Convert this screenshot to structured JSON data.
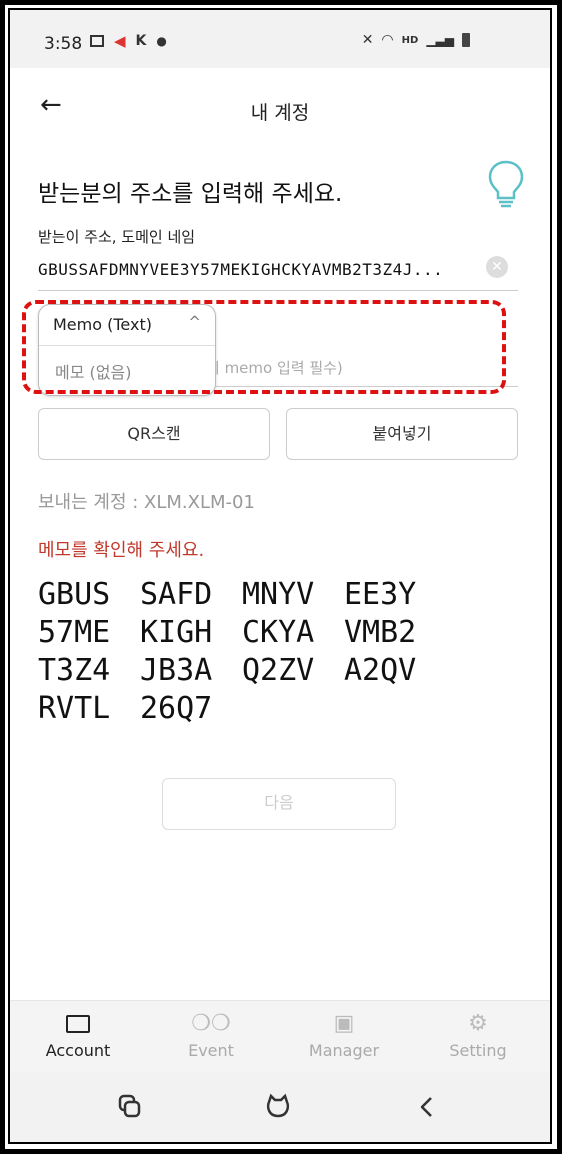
{
  "status_bar": {
    "time": "3:58",
    "left_icons": [
      "image-icon",
      "megaphone-icon",
      "k-icon",
      "dot-icon"
    ],
    "right_icons": [
      "mute-icon",
      "wifi-icon",
      "hd-voice-icon",
      "signal-icon",
      "battery-icon"
    ],
    "hd_label": "HD"
  },
  "header": {
    "title": "내 계정"
  },
  "form": {
    "heading": "받는분의 주소를 입력해 주세요.",
    "address_label": "받는이 주소, 도메인 네임",
    "address_value": "GBUSSAFDMNYVEE3Y57MEKIGHCKYAVMB2T3Z4J...",
    "memo_placeholder_visible": "시 memo 입력 필수)",
    "memo_dropdown": {
      "selected": "Memo (Text)",
      "options": [
        "메모 (없음)"
      ]
    },
    "qr_button": "QR스캔",
    "paste_button": "붙여넣기",
    "sender_account": "보내는 계정 : XLM.XLM-01",
    "warning": "메모를 확인해 주세요.",
    "memo_chunks": [
      [
        "GBUS",
        "SAFD",
        "MNYV",
        "EE3Y"
      ],
      [
        "57ME",
        "KIGH",
        "CKYA",
        "VMB2"
      ],
      [
        "T3Z4",
        "JB3A",
        "Q2ZV",
        "A2QV"
      ],
      [
        "RVTL",
        "26Q7"
      ]
    ],
    "next_button": "다음"
  },
  "bottom_nav": [
    {
      "label": "Account",
      "icon": "wallet-icon",
      "active": true
    },
    {
      "label": "Event",
      "icon": "balloons-icon",
      "active": false
    },
    {
      "label": "Manager",
      "icon": "manager-icon",
      "active": false
    },
    {
      "label": "Setting",
      "icon": "gear-icon",
      "active": false
    }
  ],
  "colors": {
    "warning": "#c0392b",
    "highlight_dash": "#dd1111",
    "bulb": "#5bc0c8"
  }
}
